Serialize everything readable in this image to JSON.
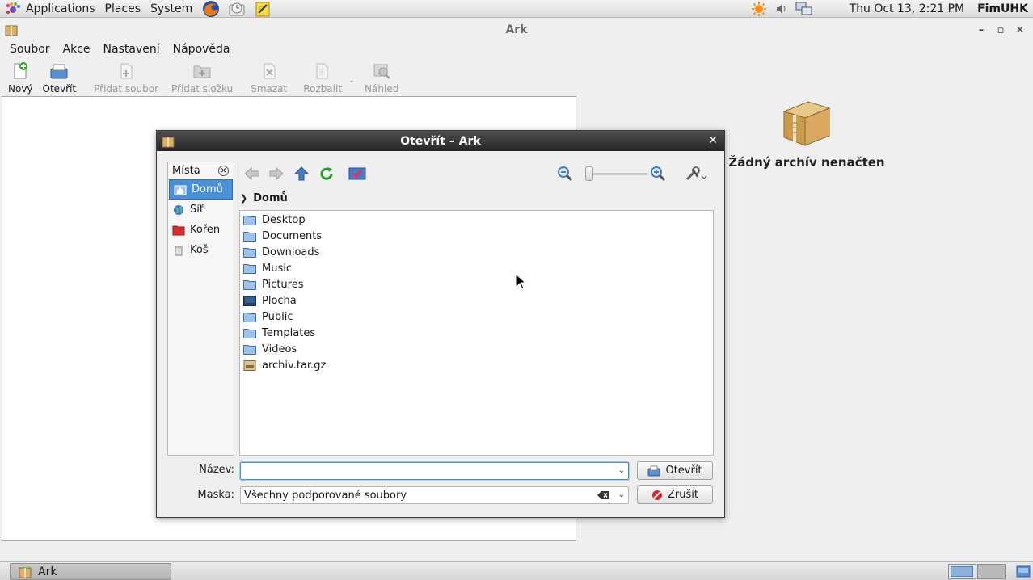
{
  "top_panel": {
    "menus": [
      "Applications",
      "Places",
      "System"
    ],
    "clock": "Thu Oct 13,  2:21 PM",
    "username": "FimUHK"
  },
  "ark": {
    "title": "Ark",
    "menu": [
      "Soubor",
      "Akce",
      "Nastavení",
      "Nápověda"
    ],
    "toolbar": [
      {
        "label": "Nový",
        "icon": "new-archive-icon",
        "enabled": true
      },
      {
        "label": "Otevřít",
        "icon": "open-archive-icon",
        "enabled": true
      },
      {
        "label": "Přidat soubor",
        "icon": "add-file-icon",
        "enabled": false
      },
      {
        "label": "Přidat složku",
        "icon": "add-folder-icon",
        "enabled": false
      },
      {
        "label": "Smazat",
        "icon": "delete-icon",
        "enabled": false
      },
      {
        "label": "Rozbalit",
        "icon": "extract-icon",
        "enabled": false
      },
      {
        "label": "Náhled",
        "icon": "preview-icon",
        "enabled": false
      }
    ],
    "no_archive_label": "Žádný archív nenačten"
  },
  "dialog": {
    "title": "Otevřít – Ark",
    "places_header": "Místa",
    "places": [
      {
        "label": "Domů",
        "icon": "home-icon",
        "selected": true
      },
      {
        "label": "Síť",
        "icon": "network-icon",
        "selected": false
      },
      {
        "label": "Kořen",
        "icon": "root-icon",
        "selected": false
      },
      {
        "label": "Koš",
        "icon": "trash-icon",
        "selected": false
      }
    ],
    "breadcrumb": "Domů",
    "files": [
      {
        "name": "Desktop",
        "icon": "folder-icon"
      },
      {
        "name": "Documents",
        "icon": "folder-icon"
      },
      {
        "name": "Downloads",
        "icon": "folder-icon"
      },
      {
        "name": "Music",
        "icon": "folder-icon"
      },
      {
        "name": "Pictures",
        "icon": "folder-icon"
      },
      {
        "name": "Plocha",
        "icon": "desktop-folder-icon"
      },
      {
        "name": "Public",
        "icon": "folder-icon"
      },
      {
        "name": "Templates",
        "icon": "folder-icon"
      },
      {
        "name": "Videos",
        "icon": "folder-icon"
      },
      {
        "name": "archiv.tar.gz",
        "icon": "archive-file-icon"
      }
    ],
    "name_label": "Název:",
    "name_value": "",
    "mask_label": "Maska:",
    "mask_value": "Všechny podporované soubory",
    "open_button": "Otevřít",
    "cancel_button": "Zrušit"
  },
  "taskbar": {
    "task_label": "Ark"
  },
  "colors": {
    "selection": "#4a90d9",
    "dialog_titlebar": "#2e2e2e"
  }
}
